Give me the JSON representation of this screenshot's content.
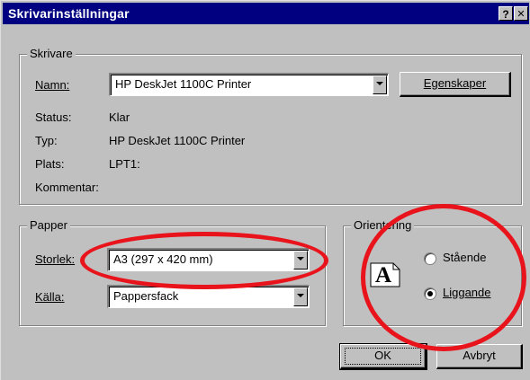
{
  "window": {
    "title": "Skrivarinställningar",
    "help_label": "?",
    "close_label": "✕"
  },
  "printer_group": {
    "legend": "Skrivare",
    "name_label": "Namn:",
    "name_value": "HP DeskJet 1100C Printer",
    "properties_button": "Egenskaper",
    "status_label": "Status:",
    "status_value": "Klar",
    "type_label": "Typ:",
    "type_value": "HP DeskJet 1100C Printer",
    "location_label": "Plats:",
    "location_value": "LPT1:",
    "comment_label": "Kommentar:"
  },
  "paper_group": {
    "legend": "Papper",
    "size_label": "Storlek:",
    "size_value": "A3 (297 x 420 mm)",
    "source_label": "Källa:",
    "source_value": "Pappersfack"
  },
  "orientation_group": {
    "legend": "Orientering",
    "icon_letter": "A",
    "options": [
      {
        "label": "Stående",
        "selected": false
      },
      {
        "label": "Liggande",
        "selected": true
      }
    ]
  },
  "buttons": {
    "ok": "OK",
    "cancel": "Avbryt"
  },
  "colors": {
    "titlebar": "#000080",
    "face": "#c0c0c0",
    "highlight_ellipse": "#e8131b"
  }
}
